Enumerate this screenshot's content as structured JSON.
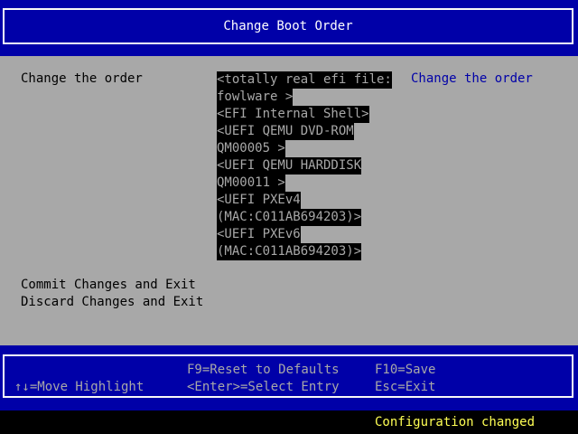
{
  "header": {
    "title": "Change Boot Order"
  },
  "main": {
    "field_label": "Change the order",
    "boot_entries": [
      "<totally real efi file:",
      "fowlware >",
      "<EFI Internal Shell>",
      "<UEFI QEMU DVD-ROM",
      "QM00005 >",
      "<UEFI QEMU HARDDISK",
      "QM00011 >",
      "<UEFI PXEv4",
      "(MAC:C011AB694203)>",
      "<UEFI PXEv6",
      "(MAC:C011AB694203)>"
    ],
    "help_text": "Change the order",
    "actions": {
      "commit": "Commit Changes and Exit",
      "discard": "Discard Changes and Exit"
    }
  },
  "footer": {
    "move_highlight": "↑↓=Move Highlight",
    "reset_defaults": "F9=Reset to Defaults",
    "select_entry": "<Enter>=Select Entry",
    "save": "F10=Save",
    "exit": "Esc=Exit"
  },
  "status": {
    "message": "Configuration changed"
  },
  "colors": {
    "title_bg": "#0000a8",
    "panel_bg": "#a8a8a8",
    "highlight_bg": "#000000",
    "help_text": "#0000a8",
    "status_text": "#ffff54"
  }
}
